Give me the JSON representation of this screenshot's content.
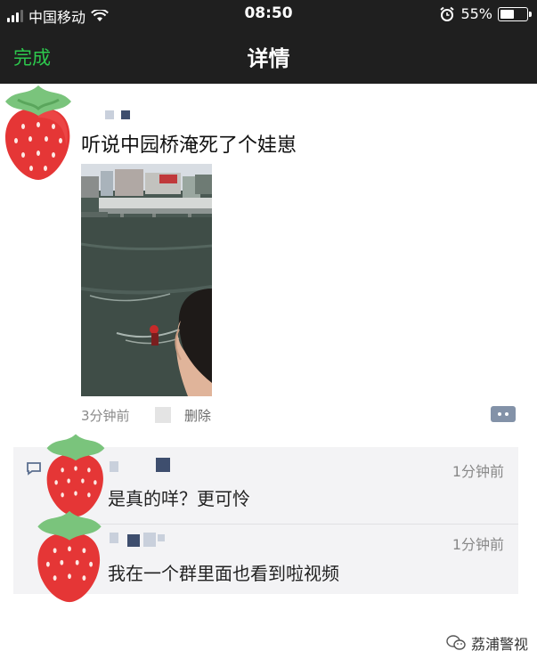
{
  "status_bar": {
    "carrier": "中国移动",
    "time": "08:50",
    "battery_percent": "55%",
    "battery_level": 0.55,
    "icons": [
      "signal-icon",
      "wifi-icon",
      "alarm-icon",
      "battery-icon"
    ]
  },
  "nav": {
    "done_label": "完成",
    "title": "详情"
  },
  "post": {
    "text": "听说中园桥淹死了个娃崽",
    "time": "3分钟前",
    "delete_label": "删除",
    "media_type": "video-thumbnail"
  },
  "comments": [
    {
      "text": "是真的咩？更可怜",
      "time": "1分钟前"
    },
    {
      "text": "我在一个群里面也看到啦视频",
      "time": "1分钟前"
    }
  ],
  "watermark": {
    "text": "荔浦警视",
    "icon": "wechat-official-account-icon"
  },
  "colors": {
    "nav_bg": "#1f1f1f",
    "done_green": "#2dc84d",
    "comment_bg": "#f3f3f5",
    "comment_button": "#8392a8"
  }
}
